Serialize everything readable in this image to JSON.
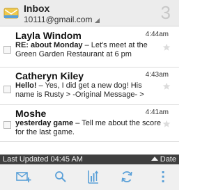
{
  "header": {
    "title": "Inbox",
    "account": "10111@gmail.com",
    "unread_count": "3",
    "icon": "inbox-envelope-icon"
  },
  "messages": [
    {
      "sender": "Layla Windom",
      "time": "4:44am",
      "subject": "RE: about Monday",
      "snippet": " – Let's meet at the Green Garden Restaurant at 6 pm"
    },
    {
      "sender": "Catheryn Kiley",
      "time": "4:43am",
      "subject": "Hello!",
      "snippet": " – Yes, I did get a new dog! His name is Rusty > -Original Message- >"
    },
    {
      "sender": "Moshe",
      "time": "4:41am",
      "subject": "yesterday game",
      "snippet": " – Tell me about the score for the last game."
    }
  ],
  "status_bar": {
    "last_updated": "Last Updated 04:45 AM",
    "sort_label": "Date"
  },
  "toolbar": {
    "icons": [
      "compose-icon",
      "search-icon",
      "sort-icon",
      "refresh-icon",
      "overflow-menu-icon"
    ]
  },
  "colors": {
    "accent_blue": "#5aa0d8",
    "envelope_yellow": "#f0c94a",
    "status_bar_bg": "#3f3f3f"
  }
}
